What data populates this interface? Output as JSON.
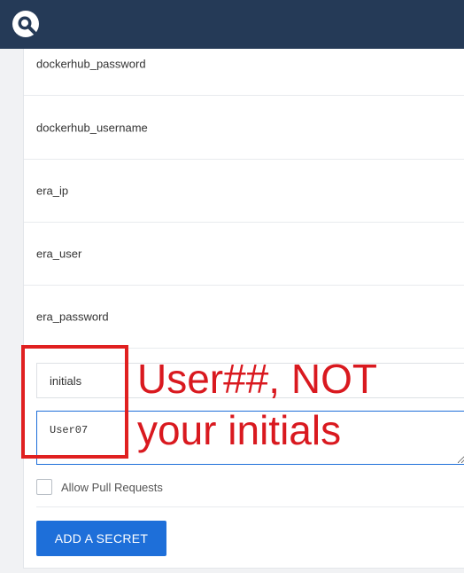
{
  "header": {
    "logo_icon": "drone-logo-icon",
    "peek_text": "era_user"
  },
  "secrets": [
    {
      "name": "dockerhub_password"
    },
    {
      "name": "dockerhub_username"
    },
    {
      "name": "era_ip"
    },
    {
      "name": "era_user"
    },
    {
      "name": "era_password"
    }
  ],
  "form": {
    "name_value": "initials",
    "secret_value": "User07",
    "allow_pull_requests_label": "Allow Pull Requests",
    "add_button_label": "ADD A SECRET"
  },
  "annotation": {
    "line1": "User##, NOT",
    "line2": "your initials",
    "color": "#e02020"
  }
}
